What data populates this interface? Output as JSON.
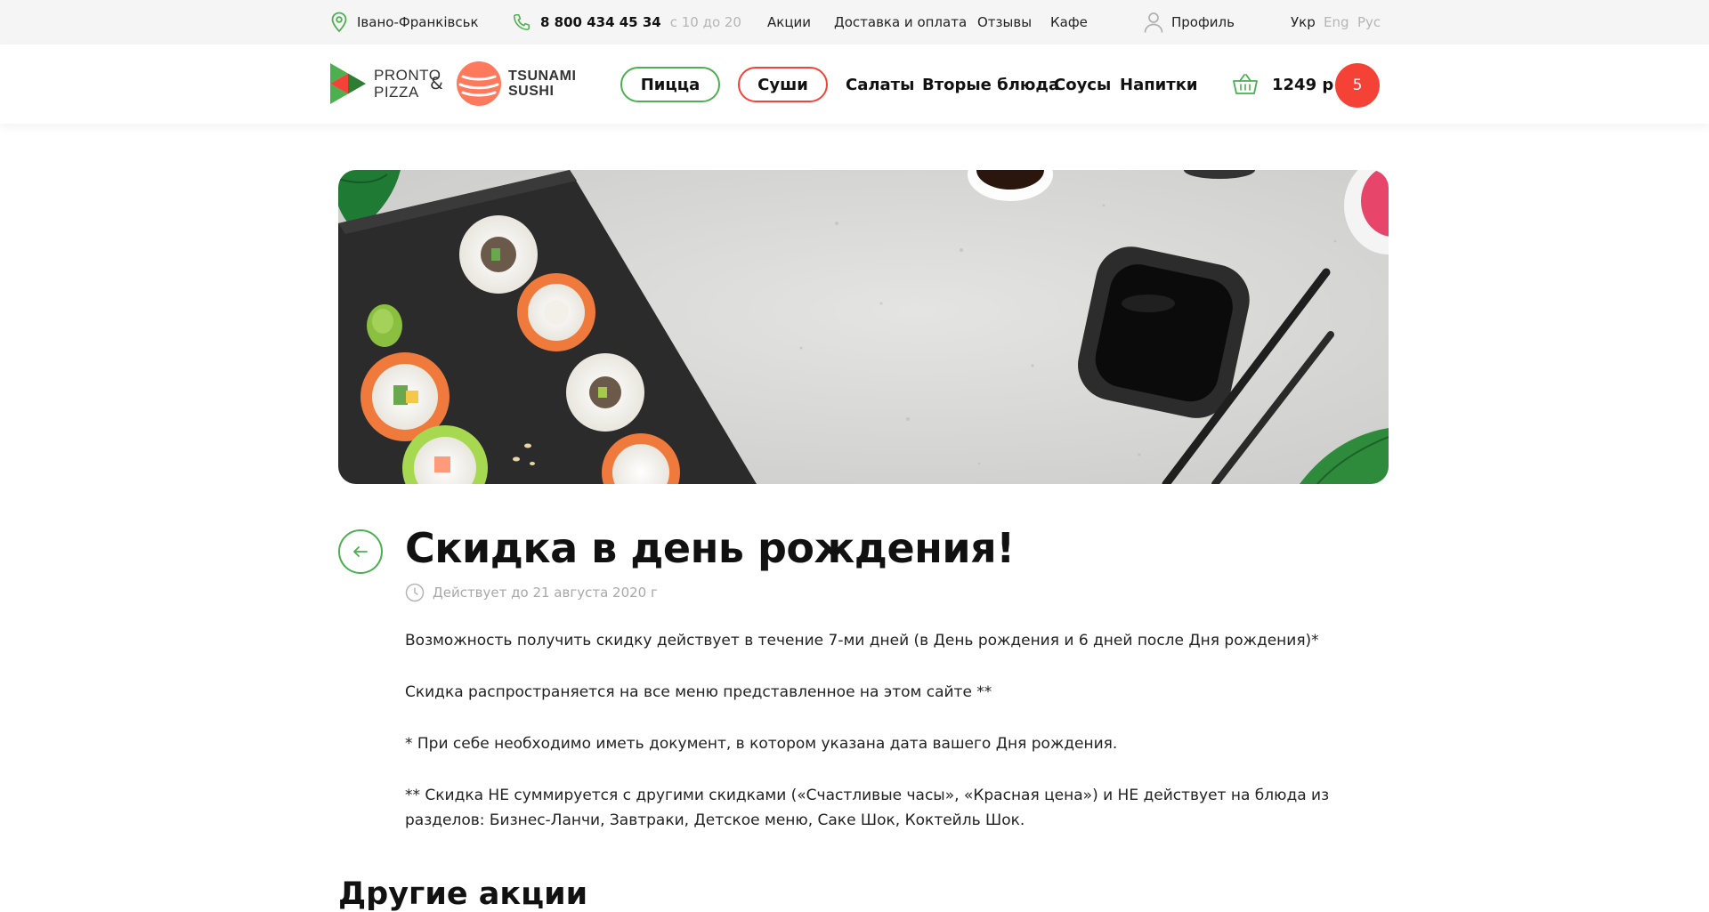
{
  "topbar": {
    "city": "Івано-Франківськ",
    "phone": "8 800 434 45 34",
    "hours": "с 10 до 20",
    "links": [
      "Акции",
      "Доставка и оплата",
      "Отзывы",
      "Кафе"
    ],
    "profile": "Профиль",
    "languages": [
      "Укр",
      "Eng",
      "Рус"
    ],
    "active_language": "Укр"
  },
  "header": {
    "logo_pronto_line1": "PRONTO",
    "logo_pronto_line2": "PIZZA",
    "logo_amp": "&",
    "logo_tsunami_line1": "TSUNAMI",
    "logo_tsunami_line2": "SUSHI",
    "nav": {
      "pizza": "Пицца",
      "sushi": "Суши",
      "salads": "Салаты",
      "mains": "Вторые блюда",
      "sauces": "Соусы",
      "drinks": "Напитки"
    },
    "cart_total": "1249 р",
    "cart_count": "5"
  },
  "promo": {
    "title": "Скидка в день рождения!",
    "valid_until": "Действует до 21 августа 2020 г",
    "paragraphs": [
      "Возможность получить скидку действует в течение 7-ми дней (в День рождения и 6 дней после Дня рождения)*",
      "Скидка распространяется на все меню представленное на этом сайте **",
      "* При себе необходимо иметь документ, в котором указана дата вашего Дня рождения.",
      "** Скидка НЕ суммируется с другими скидками («Счастливые часы», «Красная цена») и НЕ действует на блюда из разделов: Бизнес-Ланчи, Завтраки, Детское меню, Саке Шок, Коктейль Шок."
    ]
  },
  "other_promos": {
    "heading": "Другие акции"
  },
  "colors": {
    "brand_green": "#4caf50",
    "brand_red": "#f44336",
    "accent_salmon": "#ff7a5c",
    "topbar_bg": "#f5f5f5"
  }
}
